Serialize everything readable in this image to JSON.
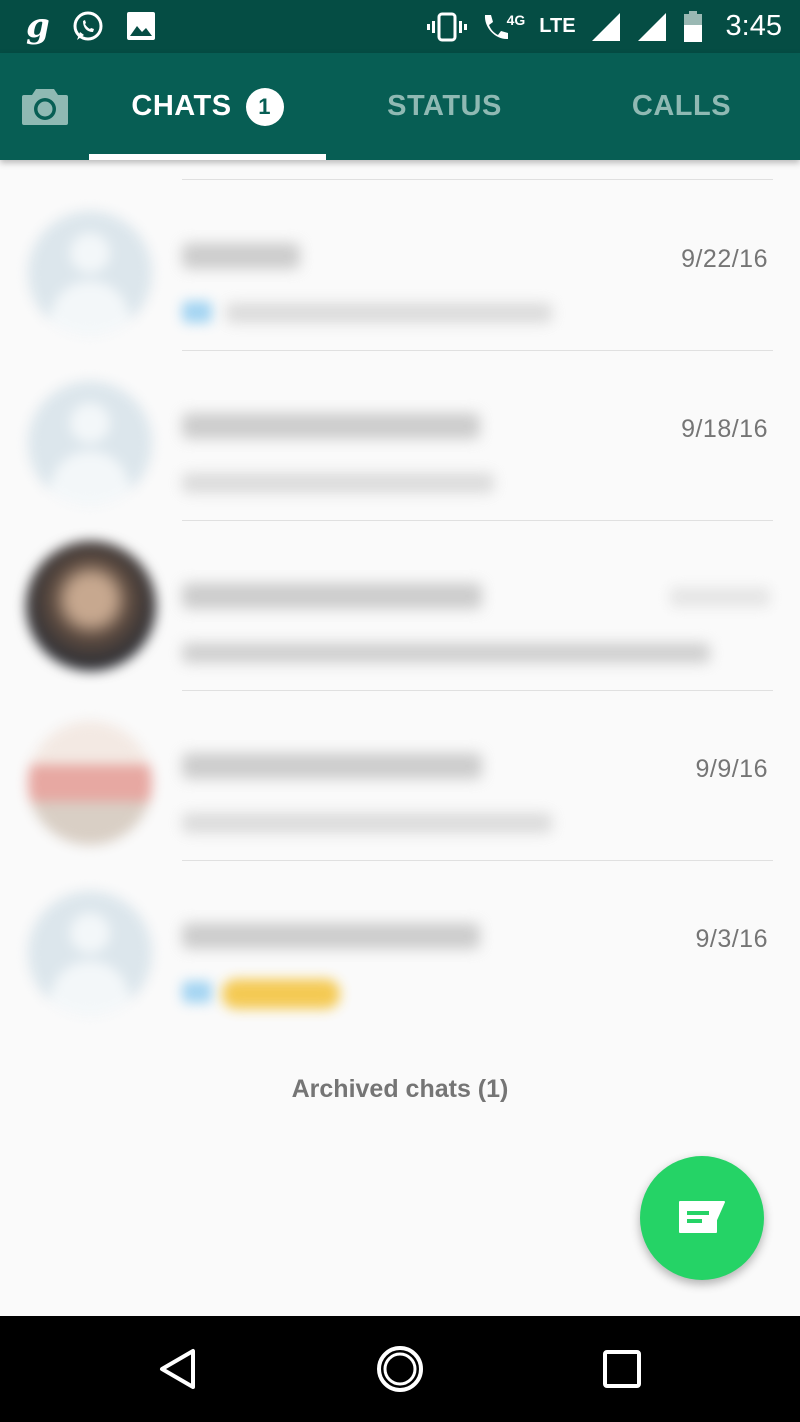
{
  "status_bar": {
    "left_icons": [
      "g-app-icon",
      "whatsapp-icon",
      "image-icon"
    ],
    "network_label": "4G",
    "lte_label": "LTE",
    "time": "3:45"
  },
  "tabs": [
    {
      "label": "CHATS",
      "badge": "1",
      "active": true
    },
    {
      "label": "STATUS",
      "active": false
    },
    {
      "label": "CALLS",
      "active": false
    }
  ],
  "chats": [
    {
      "time": "9/22/16"
    },
    {
      "time": "9/18/16"
    },
    {
      "time": ""
    },
    {
      "time": "9/9/16"
    },
    {
      "time": "9/3/16"
    }
  ],
  "archived_label": "Archived chats (1)",
  "colors": {
    "status_bar": "#054d44",
    "app_bar": "#075e54",
    "fab": "#25d366",
    "inactive_tab": "#8fb9b3"
  },
  "fab": {
    "icon": "new-chat-icon"
  },
  "nav": {
    "icons": [
      "back-icon",
      "home-icon",
      "recents-icon"
    ]
  }
}
